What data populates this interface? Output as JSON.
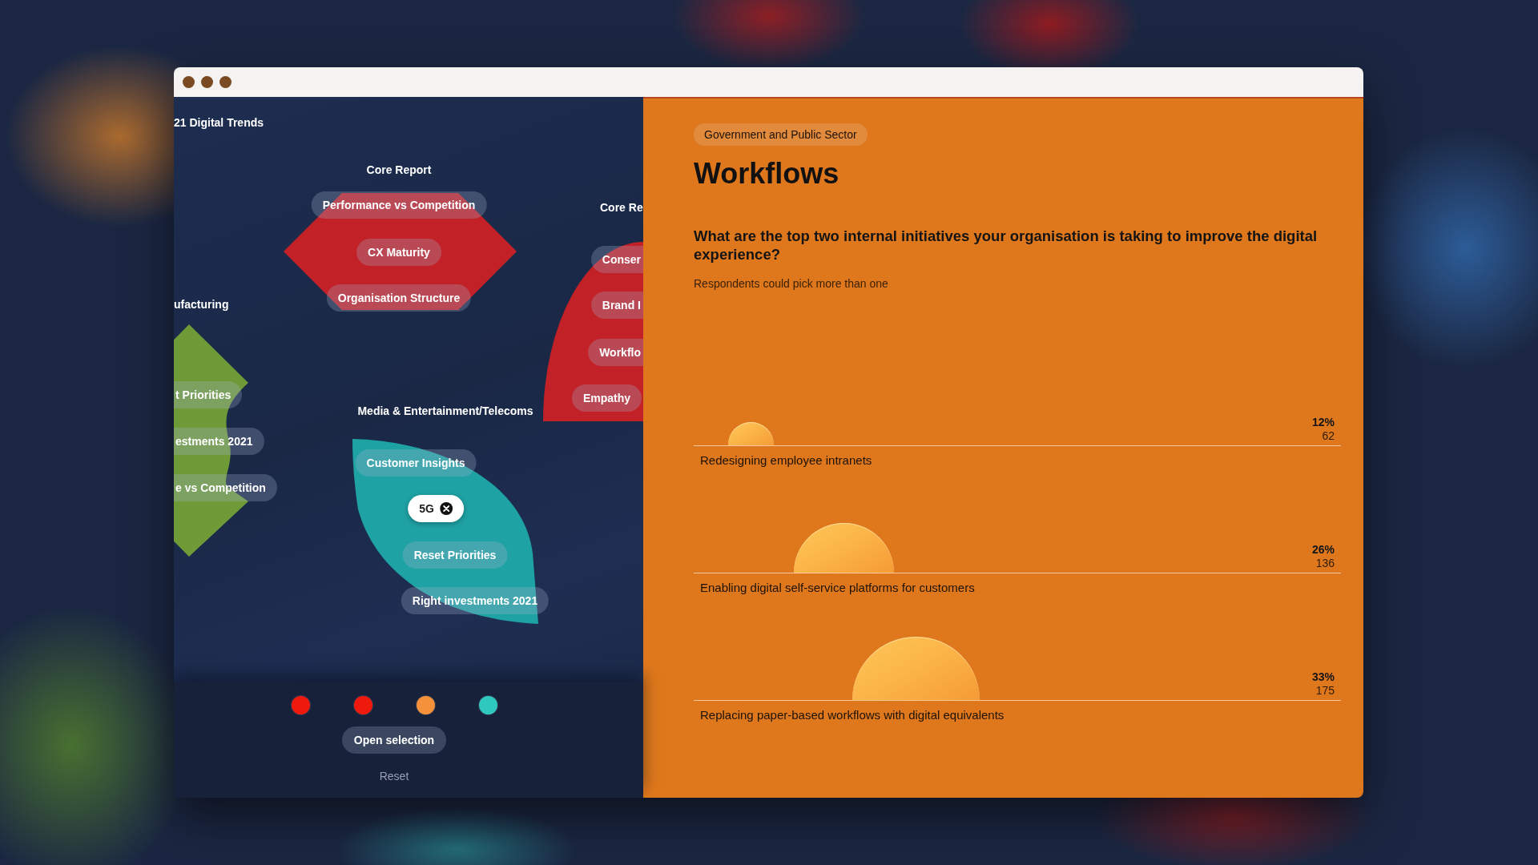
{
  "map": {
    "heading": "21 Digital Trends",
    "clusters": [
      {
        "title": "Core Report",
        "kind": "hexagon",
        "color": "#c22127",
        "topics": [
          {
            "label": "Performance vs Competition",
            "selected": false
          },
          {
            "label": "CX Maturity",
            "selected": false
          },
          {
            "label": "Organisation Structure",
            "selected": false
          }
        ]
      },
      {
        "title": "Core Re",
        "kind": "half-disc",
        "color": "#c22127",
        "topics": [
          {
            "label": "Conser",
            "selected": false
          },
          {
            "label": "Brand I",
            "selected": false
          },
          {
            "label": "Workflo",
            "selected": false
          },
          {
            "label": "Empathy",
            "selected": false
          }
        ]
      },
      {
        "title": "ufacturing",
        "kind": "arrow",
        "color": "#6e9a37",
        "topics": [
          {
            "label": "t Priorities",
            "selected": false
          },
          {
            "label": "estments 2021",
            "selected": false
          },
          {
            "label": "e vs Competition",
            "selected": false
          }
        ]
      },
      {
        "title": "Media & Entertainment/Telecoms",
        "kind": "leaf",
        "color": "#1fa2a4",
        "topics": [
          {
            "label": "Customer Insights",
            "selected": false
          },
          {
            "label": "5G",
            "selected": true
          },
          {
            "label": "Reset Priorities",
            "selected": false
          },
          {
            "label": "Right investments 2021",
            "selected": false
          }
        ]
      }
    ]
  },
  "selection": {
    "dots": [
      {
        "color": "#f0190d"
      },
      {
        "color": "#f0190d"
      },
      {
        "color": "#f5913a"
      },
      {
        "color": "#2ec8bf"
      }
    ],
    "open_button": "Open selection",
    "reset_link": "Reset"
  },
  "detail": {
    "tag": "Government and Public Sector",
    "title": "Workflows",
    "question": "What are the top two internal initiatives your organisation is taking to improve the digital experience?",
    "note": "Respondents could pick more than one",
    "results": [
      {
        "label": "Redesigning employee intranets",
        "percent": "12%",
        "count": "62",
        "level": 0.12
      },
      {
        "label": "Enabling digital self-service platforms for customers",
        "percent": "26%",
        "count": "136",
        "level": 0.26
      },
      {
        "label": "Replacing paper-based workflows with digital equivalents",
        "percent": "33%",
        "count": "175",
        "level": 0.33
      }
    ]
  }
}
